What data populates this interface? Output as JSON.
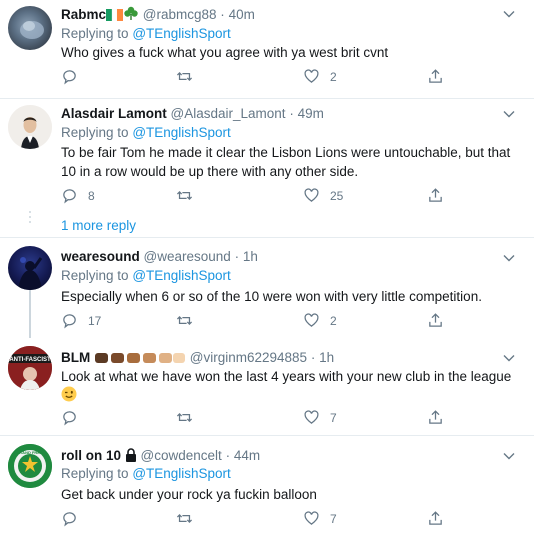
{
  "tweets": [
    {
      "name": "Rabmc",
      "handle": "@rabmcg88",
      "time": "40m",
      "replying_to_label": "Replying to",
      "replying_to": "@TEnglishSport",
      "text": "Who gives a fuck what you agree with ya west brit cvnt",
      "likes": "2",
      "replies": "",
      "retweets": ""
    },
    {
      "name": "Alasdair Lamont",
      "handle": "@Alasdair_Lamont",
      "time": "49m",
      "replying_to_label": "Replying to",
      "replying_to": "@TEnglishSport",
      "text": "To be fair Tom he made it clear the Lisbon Lions were untouchable, but that 10 in a row would be up there with any other side.",
      "replies": "8",
      "likes": "25",
      "retweets": ""
    },
    {
      "name": "wearesound",
      "handle": "@wearesound",
      "time": "1h",
      "replying_to_label": "Replying to",
      "replying_to": "@TEnglishSport",
      "text": "Especially when 6 or so of the 10 were won with very little competition.",
      "replies": "17",
      "likes": "2",
      "retweets": ""
    },
    {
      "name": "BLM",
      "handle": "@virginm62294885",
      "time": "1h",
      "text": "Look at what we have won the last 4 years with your new club in the league",
      "avatar_text": "ANTI-FASCIST",
      "replies": "",
      "likes": "7",
      "retweets": ""
    },
    {
      "name": "roll on 10",
      "handle": "@cowdencelt",
      "time": "44m",
      "replying_to_label": "Replying to",
      "replying_to": "@TEnglishSport",
      "text": "Get back under your rock ya fuckin balloon",
      "avatar_text": "STAND FREE",
      "replies": "",
      "likes": "7",
      "retweets": ""
    }
  ],
  "more_replies": "1 more reply",
  "separator": "·",
  "colors": {
    "link": "#1b95e0",
    "muted": "#657786",
    "text": "#14171a",
    "divider": "#e6ecf0"
  },
  "icons": [
    "reply-icon",
    "retweet-icon",
    "like-icon",
    "share-icon",
    "chevron-down-icon",
    "lock-icon"
  ]
}
